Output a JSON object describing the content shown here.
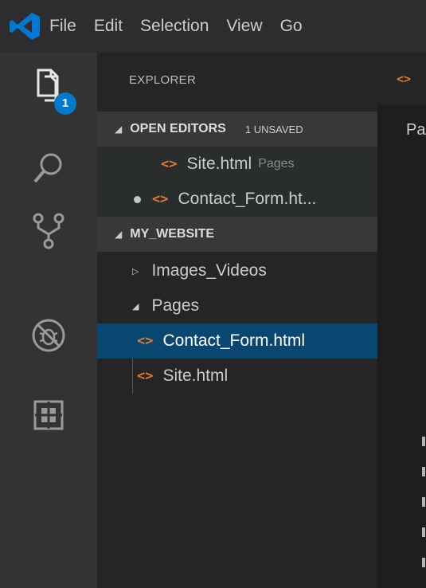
{
  "menubar": {
    "items": [
      "File",
      "Edit",
      "Selection",
      "View",
      "Go"
    ]
  },
  "activitybar": {
    "icons": [
      "files-icon",
      "search-icon",
      "source-control-icon",
      "debug-icon",
      "extensions-icon"
    ],
    "explorer_badge": "1"
  },
  "sidebar": {
    "title": "EXPLORER",
    "open_editors": {
      "title": "OPEN EDITORS",
      "unsaved": "1 UNSAVED",
      "items": [
        {
          "name": "Site.html",
          "hint": "Pages"
        },
        {
          "name": "Contact_Form.ht..."
        }
      ]
    },
    "folder": {
      "title": "MY_WEBSITE",
      "items": [
        "Images_Videos",
        "Pages",
        "Contact_Form.html",
        "Site.html"
      ]
    }
  },
  "editor": {
    "breadcrumb": "Pa"
  },
  "colors": {
    "accent": "#007acc",
    "selection": "#094771",
    "html_icon": "#e37933"
  }
}
